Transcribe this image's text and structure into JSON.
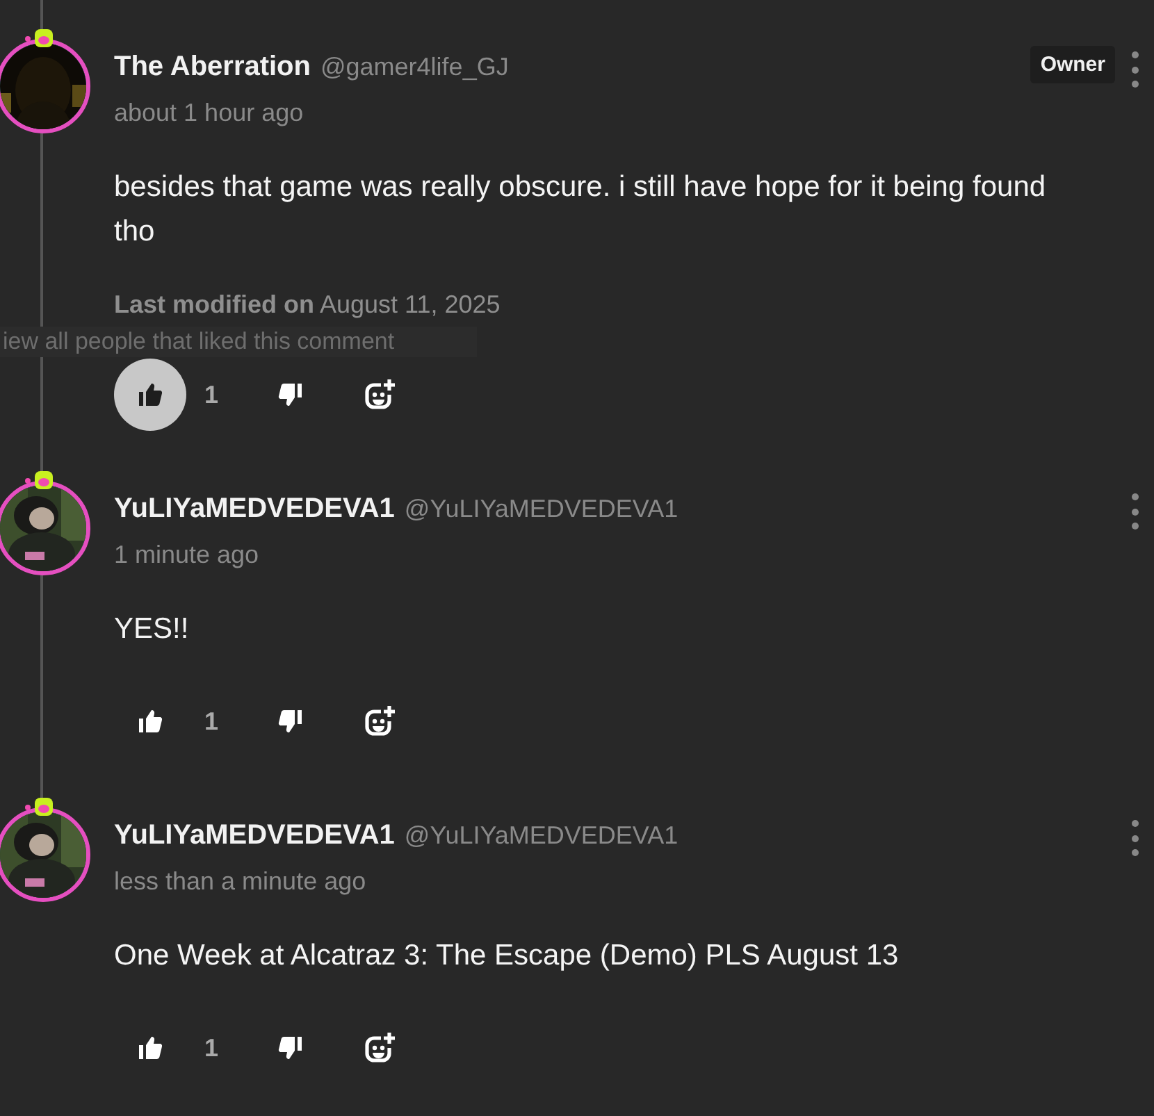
{
  "comments": [
    {
      "name": "The Aberration",
      "handle": "@gamer4life_GJ",
      "badge": "Owner",
      "time": "about 1 hour ago",
      "body": "besides that game was really obscure. i still have hope for it being found tho",
      "modified": "**Last modified on** August 11, 2025",
      "tooltip": "iew all people that liked this comment",
      "likes": "1",
      "liked": true
    },
    {
      "name": "YuLIYaMEDVEDEVA1",
      "handle": "@YuLIYaMEDVEDEVA1",
      "time": "1 minute ago",
      "body": "YES!!",
      "likes": "1",
      "liked": false
    },
    {
      "name": "YuLIYaMEDVEDEVA1",
      "handle": "@YuLIYaMEDVEDEVA1",
      "time": "less than a minute ago",
      "body": "One Week at Alcatraz 3: The Escape (Demo) PLS August 13",
      "likes": "1",
      "liked": false
    }
  ]
}
